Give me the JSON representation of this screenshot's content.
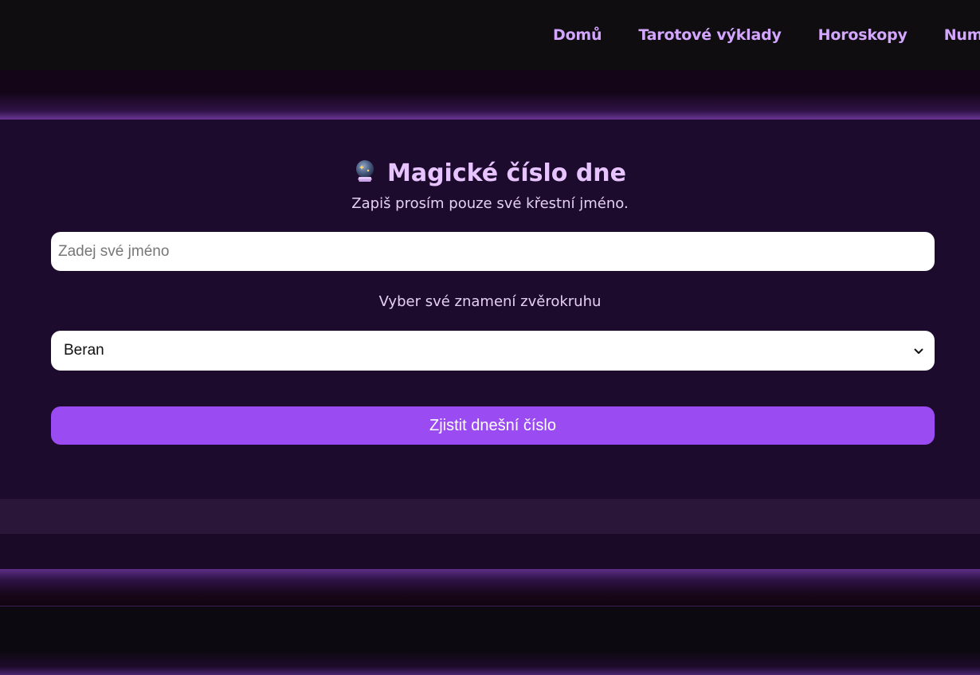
{
  "nav": {
    "items": [
      {
        "label": "Domů"
      },
      {
        "label": "Tarotové výklady"
      },
      {
        "label": "Horoskopy"
      },
      {
        "label": "Num"
      }
    ]
  },
  "form": {
    "title": "Magické číslo dne",
    "title_icon": "crystal-ball-icon",
    "subtitle": "Zapiš prosím pouze své křestní jméno.",
    "name_placeholder": "Zadej své jméno",
    "name_value": "",
    "zodiac_label": "Vyber své znamení zvěrokruhu",
    "zodiac_selected": "Beran",
    "submit_label": "Zjistit dnešní číslo"
  },
  "colors": {
    "nav_link": "#d3a6ff",
    "title": "#e7c4ff",
    "panel_bg": "#1d0b2d",
    "button_bg": "#9b4bf2"
  }
}
